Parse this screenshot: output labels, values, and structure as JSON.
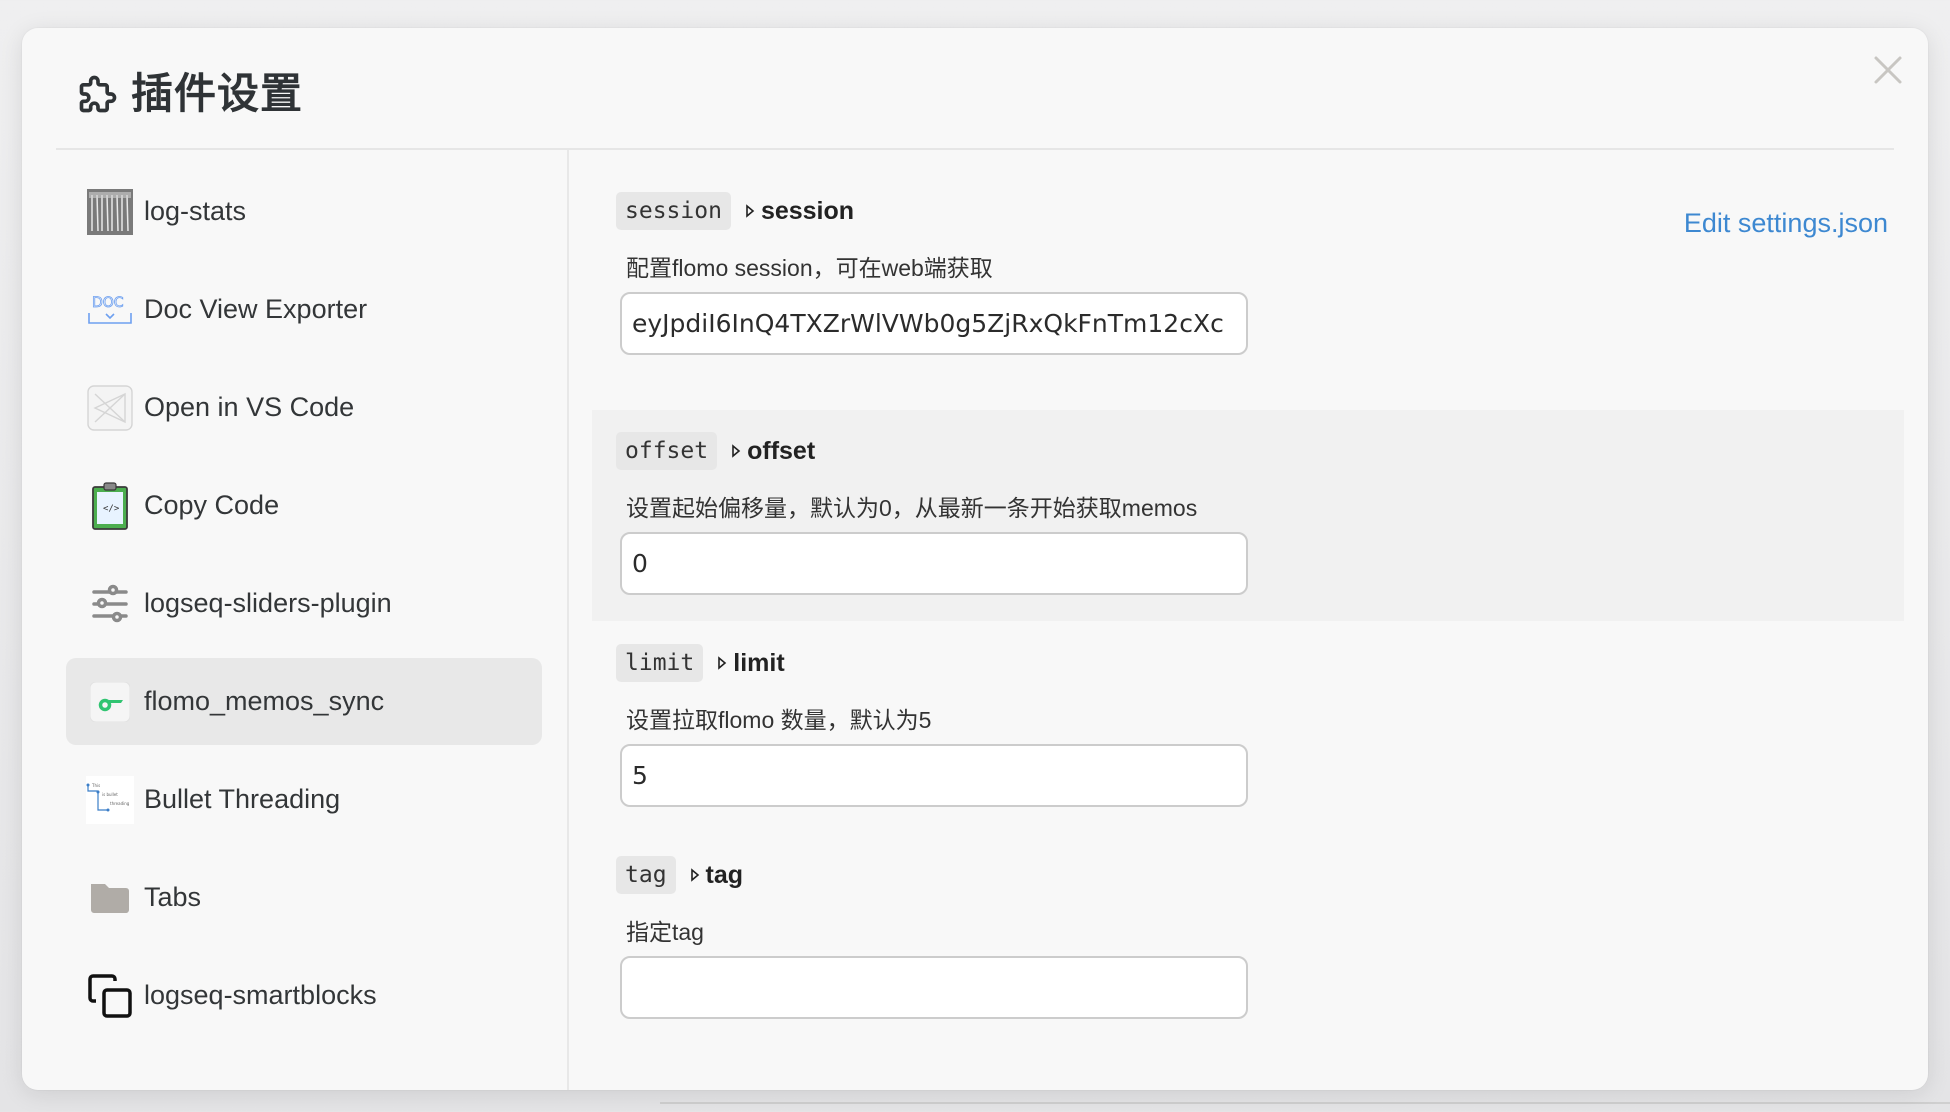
{
  "dialog": {
    "title": "插件设置",
    "title_icon": "puzzle-icon",
    "close_icon": "close-icon"
  },
  "sidebar": {
    "items": [
      {
        "label": "log-stats",
        "icon": "log-stats-thumbnail-icon",
        "selected": false
      },
      {
        "label": "Doc View Exporter",
        "icon": "doc-export-icon",
        "selected": false
      },
      {
        "label": "Open in VS Code",
        "icon": "vscode-placeholder-icon",
        "selected": false
      },
      {
        "label": "Copy Code",
        "icon": "clipboard-code-icon",
        "selected": false
      },
      {
        "label": "logseq-sliders-plugin",
        "icon": "sliders-icon",
        "selected": false
      },
      {
        "label": "flomo_memos_sync",
        "icon": "flomo-icon",
        "selected": true
      },
      {
        "label": "Bullet Threading",
        "icon": "bullet-threading-thumbnail-icon",
        "selected": false
      },
      {
        "label": "Tabs",
        "icon": "folder-icon",
        "selected": false
      },
      {
        "label": "logseq-smartblocks",
        "icon": "copy-blocks-icon",
        "selected": false
      }
    ]
  },
  "content": {
    "edit_link": "Edit settings.json",
    "link_color": "#3d88d1",
    "settings": [
      {
        "key": "session",
        "title": "session",
        "description": "配置flomo session，可在web端获取",
        "value": "eyJpdiI6InQ4TXZrWlVWb0g5ZjRxQkFnTm12cXc",
        "placeholder": "",
        "highlighted": false
      },
      {
        "key": "offset",
        "title": "offset",
        "description": "设置起始偏移量，默认为0，从最新一条开始获取memos",
        "value": "0",
        "placeholder": "",
        "highlighted": true
      },
      {
        "key": "limit",
        "title": "limit",
        "description": "设置拉取flomo 数量，默认为5",
        "value": "5",
        "placeholder": "",
        "highlighted": false
      },
      {
        "key": "tag",
        "title": "tag",
        "description": "指定tag",
        "value": "",
        "placeholder": "",
        "highlighted": false
      }
    ]
  }
}
